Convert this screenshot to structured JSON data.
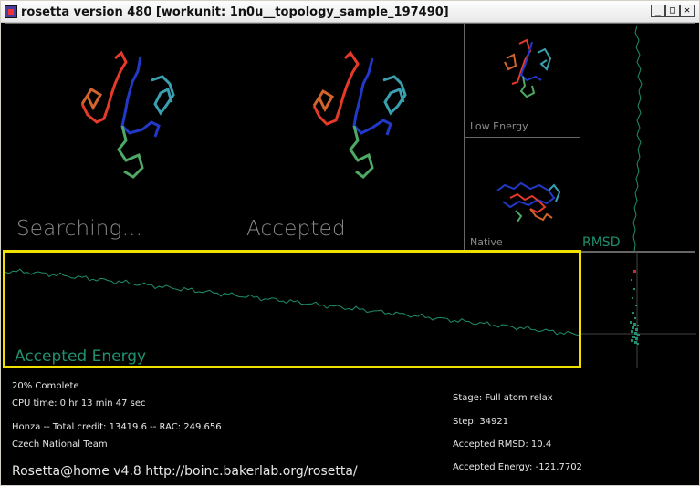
{
  "window": {
    "title": "rosetta version 480 [workunit: 1n0u__topology_sample_197490]",
    "buttons": [
      "minimize",
      "maximize",
      "close"
    ]
  },
  "panels": {
    "searching": {
      "label": "Searching..."
    },
    "accepted": {
      "label": "Accepted"
    },
    "low_energy": {
      "label": "Low  Energy"
    },
    "native": {
      "label": "Native"
    },
    "rmsd": {
      "label": "RMSD"
    },
    "energy_plot": {
      "label": "Accepted  Energy"
    }
  },
  "status": {
    "percent": "20%  Complete",
    "cpu_time": "CPU  time:  0  hr  13  min  47  sec",
    "user": "Honza  --  Total  credit:  13419.6  --  RAC:  249.656",
    "team": "Czech  National  Team",
    "app": "Rosetta@home   v4.8   http://boinc.bakerlab.org/rosetta/"
  },
  "stats": {
    "stage": "Stage:  Full  atom  relax",
    "step": "Step:  34921",
    "rmsd": "Accepted  RMSD:     10.4",
    "energy": "Accepted  Energy:  -121.7702"
  },
  "colors": {
    "plot_line": "#1f8f6f",
    "panel_border": "#666666",
    "highlight": "#f0e000",
    "label_gray": "#8a8a8a",
    "accepted_energy_label": "#1f8f6f"
  }
}
